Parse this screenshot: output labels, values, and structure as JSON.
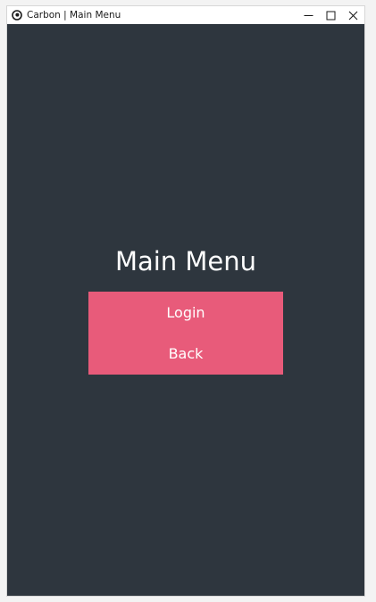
{
  "window": {
    "title": "Carbon | Main Menu",
    "icon": "app-logo-icon",
    "controls": {
      "minimize": "minimize-icon",
      "maximize": "maximize-icon",
      "close": "close-icon"
    }
  },
  "main": {
    "heading": "Main Menu",
    "buttons": {
      "login_label": "Login",
      "back_label": "Back"
    }
  },
  "colors": {
    "background": "#2e363e",
    "accent": "#e85b7a",
    "text": "#ffffff"
  }
}
